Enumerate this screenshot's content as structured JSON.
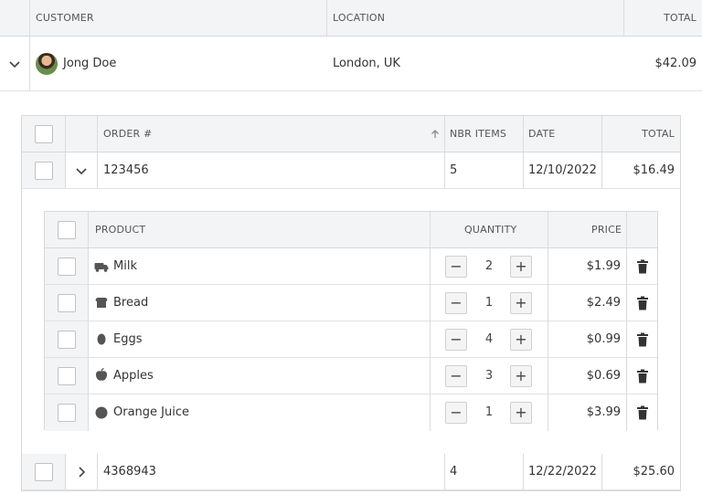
{
  "customers_grid": {
    "headers": {
      "customer": "CUSTOMER",
      "location": "LOCATION",
      "total": "TOTAL"
    },
    "row": {
      "name": "Jong Doe",
      "location": "London, UK",
      "total": "$42.09"
    }
  },
  "orders_grid": {
    "headers": {
      "order": "ORDER #",
      "items": "NBR ITEMS",
      "date": "DATE",
      "total": "TOTAL"
    },
    "rows": [
      {
        "order": "123456",
        "items": "5",
        "date": "12/10/2022",
        "total": "$16.49"
      },
      {
        "order": "4368943",
        "items": "4",
        "date": "12/22/2022",
        "total": "$25.60"
      }
    ]
  },
  "products_grid": {
    "headers": {
      "product": "PRODUCT",
      "quantity": "QUANTITY",
      "price": "PRICE"
    },
    "rows": [
      {
        "icon": "milk-truck-icon",
        "name": "Milk",
        "qty": "2",
        "price": "$1.99"
      },
      {
        "icon": "bread-icon",
        "name": "Bread",
        "qty": "1",
        "price": "$2.49"
      },
      {
        "icon": "egg-icon",
        "name": "Eggs",
        "qty": "4",
        "price": "$0.99"
      },
      {
        "icon": "apple-icon",
        "name": "Apples",
        "qty": "3",
        "price": "$0.69"
      },
      {
        "icon": "circle-icon",
        "name": "Orange Juice",
        "qty": "1",
        "price": "$3.99"
      }
    ],
    "minus_label": "−",
    "plus_label": "+"
  }
}
